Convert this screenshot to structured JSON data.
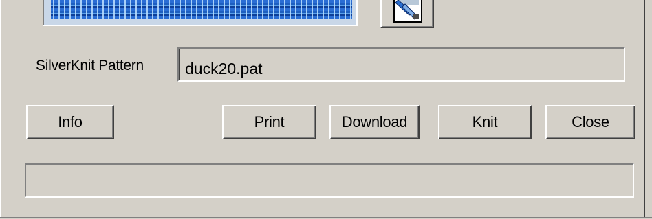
{
  "pattern": {
    "label": "SilverKnit Pattern",
    "value": "duck20.pat"
  },
  "buttons": {
    "info": "Info",
    "print": "Print",
    "download": "Download",
    "knit": "Knit",
    "close": "Close"
  },
  "status_bar": {
    "text": ""
  },
  "icons": {
    "preview_button": "knit-tool-icon"
  },
  "colors": {
    "dialog_bg": "#d4d0c8",
    "knit_preview": "#1e5fc0"
  }
}
